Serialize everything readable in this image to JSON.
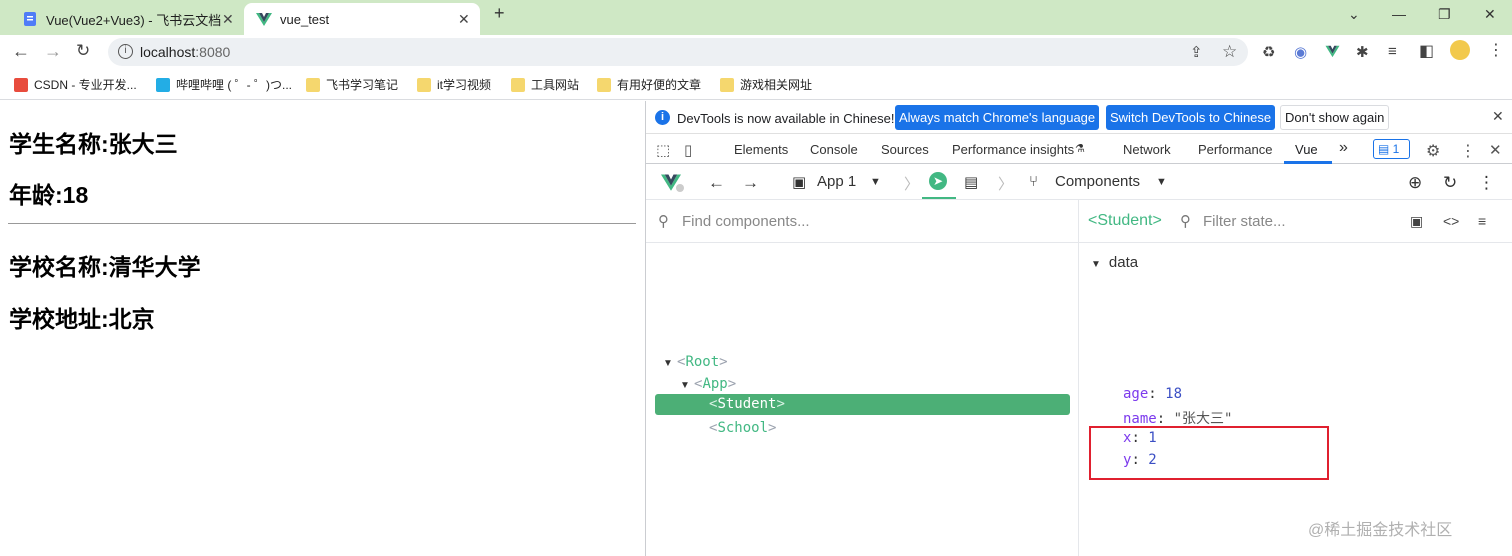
{
  "browser": {
    "tabs": [
      {
        "title": "Vue(Vue2+Vue3) - 飞书云文档",
        "active": false
      },
      {
        "title": "vue_test",
        "active": true
      }
    ],
    "new_tab_label": "+",
    "url_host": "localhost",
    "url_port": ":8080",
    "bookmarks": [
      "CSDN - 专业开发...",
      "哔哩哔哩 ( ゜- ゜)つ...",
      "飞书学习笔记",
      "it学习视频",
      "工具网站",
      "有用好便的文章",
      "游戏相关网址"
    ]
  },
  "page": {
    "student_name": "学生名称:张大三",
    "student_age": "年龄:18",
    "school_name": "学校名称:清华大学",
    "school_address": "学校地址:北京"
  },
  "devtools": {
    "infobar": {
      "message": "DevTools is now available in Chinese!",
      "btn_match": "Always match Chrome's language",
      "btn_switch": "Switch DevTools to Chinese",
      "btn_dismiss": "Don't show again"
    },
    "tabs": [
      "Elements",
      "Console",
      "Sources",
      "Performance insights",
      "Network",
      "Performance",
      "Vue"
    ],
    "active_tab": "Vue",
    "more_tabs": "»",
    "message_count": "1",
    "vue": {
      "app_selector": "App 1",
      "view_selector": "Components",
      "find_placeholder": "Find components...",
      "tree": {
        "root": "Root",
        "app": "App",
        "student": "Student",
        "school": "School"
      },
      "selected_component": "<Student>",
      "filter_placeholder": "Filter state...",
      "data_section": "data",
      "state": [
        {
          "key": "age",
          "value": "18",
          "type": "number"
        },
        {
          "key": "name",
          "value": "\"张大三\"",
          "type": "string"
        },
        {
          "key": "x",
          "value": "1",
          "type": "number"
        },
        {
          "key": "y",
          "value": "2",
          "type": "number"
        }
      ]
    }
  },
  "watermark": "@稀土掘金技术社区",
  "colors": {
    "vue_green": "#42b883",
    "highlight_red": "#e0202f",
    "accent_blue": "#1a73e8",
    "tabstrip": "#cfe8c5"
  }
}
